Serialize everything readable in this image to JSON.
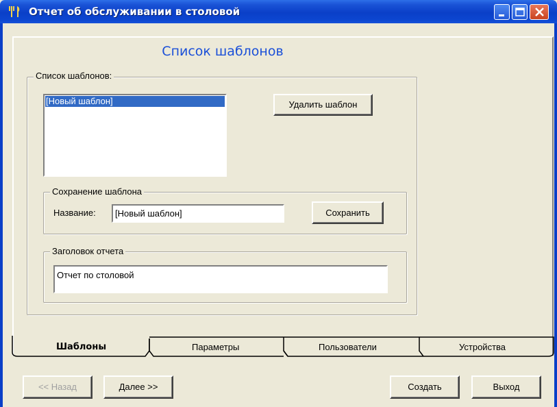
{
  "window": {
    "title": "Отчет об обслуживании в столовой",
    "icon": "fork-knife-icon"
  },
  "page": {
    "heading": "Список шаблонов"
  },
  "templates_group": {
    "legend": "Список шаблонов:",
    "items": [
      "[Новый шаблон]"
    ],
    "selected_index": 0,
    "delete_button": "Удалить шаблон"
  },
  "save_group": {
    "legend": "Сохранение шаблона",
    "name_label": "Название:",
    "name_value": "[Новый шаблон]",
    "save_button": "Сохранить"
  },
  "report_header_group": {
    "legend": "Заголовок отчета",
    "value": "Отчет по столовой"
  },
  "tabs": [
    {
      "label": "Шаблоны",
      "active": true
    },
    {
      "label": "Параметры",
      "active": false
    },
    {
      "label": "Пользователи",
      "active": false
    },
    {
      "label": "Устройства",
      "active": false
    }
  ],
  "footer": {
    "back_button": "<< Назад",
    "back_enabled": false,
    "next_button": "Далее >>",
    "create_button": "Создать",
    "exit_button": "Выход"
  },
  "colors": {
    "title_bar": "#0a3fc8",
    "heading": "#1a4fd8",
    "selection": "#316ac5",
    "face": "#ece9d8"
  }
}
